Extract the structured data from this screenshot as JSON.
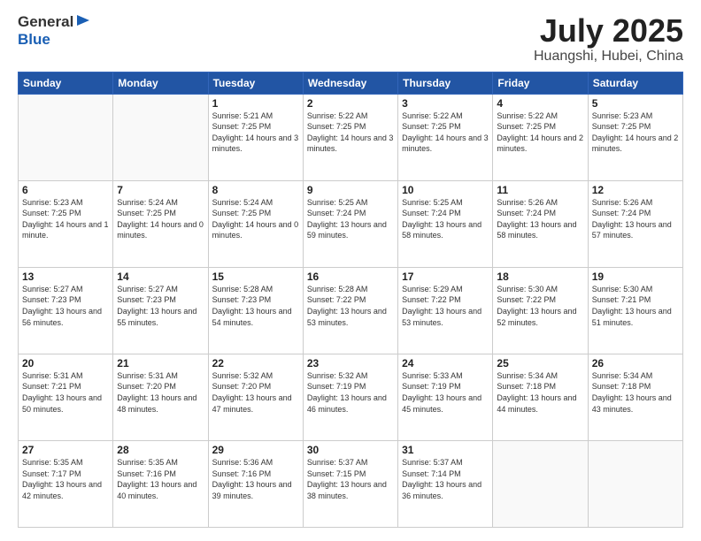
{
  "header": {
    "logo_general": "General",
    "logo_blue": "Blue",
    "month_title": "July 2025",
    "location": "Huangshi, Hubei, China"
  },
  "weekdays": [
    "Sunday",
    "Monday",
    "Tuesday",
    "Wednesday",
    "Thursday",
    "Friday",
    "Saturday"
  ],
  "weeks": [
    [
      {
        "day": "",
        "sunrise": "",
        "sunset": "",
        "daylight": ""
      },
      {
        "day": "",
        "sunrise": "",
        "sunset": "",
        "daylight": ""
      },
      {
        "day": "1",
        "sunrise": "Sunrise: 5:21 AM",
        "sunset": "Sunset: 7:25 PM",
        "daylight": "Daylight: 14 hours and 3 minutes."
      },
      {
        "day": "2",
        "sunrise": "Sunrise: 5:22 AM",
        "sunset": "Sunset: 7:25 PM",
        "daylight": "Daylight: 14 hours and 3 minutes."
      },
      {
        "day": "3",
        "sunrise": "Sunrise: 5:22 AM",
        "sunset": "Sunset: 7:25 PM",
        "daylight": "Daylight: 14 hours and 3 minutes."
      },
      {
        "day": "4",
        "sunrise": "Sunrise: 5:22 AM",
        "sunset": "Sunset: 7:25 PM",
        "daylight": "Daylight: 14 hours and 2 minutes."
      },
      {
        "day": "5",
        "sunrise": "Sunrise: 5:23 AM",
        "sunset": "Sunset: 7:25 PM",
        "daylight": "Daylight: 14 hours and 2 minutes."
      }
    ],
    [
      {
        "day": "6",
        "sunrise": "Sunrise: 5:23 AM",
        "sunset": "Sunset: 7:25 PM",
        "daylight": "Daylight: 14 hours and 1 minute."
      },
      {
        "day": "7",
        "sunrise": "Sunrise: 5:24 AM",
        "sunset": "Sunset: 7:25 PM",
        "daylight": "Daylight: 14 hours and 0 minutes."
      },
      {
        "day": "8",
        "sunrise": "Sunrise: 5:24 AM",
        "sunset": "Sunset: 7:25 PM",
        "daylight": "Daylight: 14 hours and 0 minutes."
      },
      {
        "day": "9",
        "sunrise": "Sunrise: 5:25 AM",
        "sunset": "Sunset: 7:24 PM",
        "daylight": "Daylight: 13 hours and 59 minutes."
      },
      {
        "day": "10",
        "sunrise": "Sunrise: 5:25 AM",
        "sunset": "Sunset: 7:24 PM",
        "daylight": "Daylight: 13 hours and 58 minutes."
      },
      {
        "day": "11",
        "sunrise": "Sunrise: 5:26 AM",
        "sunset": "Sunset: 7:24 PM",
        "daylight": "Daylight: 13 hours and 58 minutes."
      },
      {
        "day": "12",
        "sunrise": "Sunrise: 5:26 AM",
        "sunset": "Sunset: 7:24 PM",
        "daylight": "Daylight: 13 hours and 57 minutes."
      }
    ],
    [
      {
        "day": "13",
        "sunrise": "Sunrise: 5:27 AM",
        "sunset": "Sunset: 7:23 PM",
        "daylight": "Daylight: 13 hours and 56 minutes."
      },
      {
        "day": "14",
        "sunrise": "Sunrise: 5:27 AM",
        "sunset": "Sunset: 7:23 PM",
        "daylight": "Daylight: 13 hours and 55 minutes."
      },
      {
        "day": "15",
        "sunrise": "Sunrise: 5:28 AM",
        "sunset": "Sunset: 7:23 PM",
        "daylight": "Daylight: 13 hours and 54 minutes."
      },
      {
        "day": "16",
        "sunrise": "Sunrise: 5:28 AM",
        "sunset": "Sunset: 7:22 PM",
        "daylight": "Daylight: 13 hours and 53 minutes."
      },
      {
        "day": "17",
        "sunrise": "Sunrise: 5:29 AM",
        "sunset": "Sunset: 7:22 PM",
        "daylight": "Daylight: 13 hours and 53 minutes."
      },
      {
        "day": "18",
        "sunrise": "Sunrise: 5:30 AM",
        "sunset": "Sunset: 7:22 PM",
        "daylight": "Daylight: 13 hours and 52 minutes."
      },
      {
        "day": "19",
        "sunrise": "Sunrise: 5:30 AM",
        "sunset": "Sunset: 7:21 PM",
        "daylight": "Daylight: 13 hours and 51 minutes."
      }
    ],
    [
      {
        "day": "20",
        "sunrise": "Sunrise: 5:31 AM",
        "sunset": "Sunset: 7:21 PM",
        "daylight": "Daylight: 13 hours and 50 minutes."
      },
      {
        "day": "21",
        "sunrise": "Sunrise: 5:31 AM",
        "sunset": "Sunset: 7:20 PM",
        "daylight": "Daylight: 13 hours and 48 minutes."
      },
      {
        "day": "22",
        "sunrise": "Sunrise: 5:32 AM",
        "sunset": "Sunset: 7:20 PM",
        "daylight": "Daylight: 13 hours and 47 minutes."
      },
      {
        "day": "23",
        "sunrise": "Sunrise: 5:32 AM",
        "sunset": "Sunset: 7:19 PM",
        "daylight": "Daylight: 13 hours and 46 minutes."
      },
      {
        "day": "24",
        "sunrise": "Sunrise: 5:33 AM",
        "sunset": "Sunset: 7:19 PM",
        "daylight": "Daylight: 13 hours and 45 minutes."
      },
      {
        "day": "25",
        "sunrise": "Sunrise: 5:34 AM",
        "sunset": "Sunset: 7:18 PM",
        "daylight": "Daylight: 13 hours and 44 minutes."
      },
      {
        "day": "26",
        "sunrise": "Sunrise: 5:34 AM",
        "sunset": "Sunset: 7:18 PM",
        "daylight": "Daylight: 13 hours and 43 minutes."
      }
    ],
    [
      {
        "day": "27",
        "sunrise": "Sunrise: 5:35 AM",
        "sunset": "Sunset: 7:17 PM",
        "daylight": "Daylight: 13 hours and 42 minutes."
      },
      {
        "day": "28",
        "sunrise": "Sunrise: 5:35 AM",
        "sunset": "Sunset: 7:16 PM",
        "daylight": "Daylight: 13 hours and 40 minutes."
      },
      {
        "day": "29",
        "sunrise": "Sunrise: 5:36 AM",
        "sunset": "Sunset: 7:16 PM",
        "daylight": "Daylight: 13 hours and 39 minutes."
      },
      {
        "day": "30",
        "sunrise": "Sunrise: 5:37 AM",
        "sunset": "Sunset: 7:15 PM",
        "daylight": "Daylight: 13 hours and 38 minutes."
      },
      {
        "day": "31",
        "sunrise": "Sunrise: 5:37 AM",
        "sunset": "Sunset: 7:14 PM",
        "daylight": "Daylight: 13 hours and 36 minutes."
      },
      {
        "day": "",
        "sunrise": "",
        "sunset": "",
        "daylight": ""
      },
      {
        "day": "",
        "sunrise": "",
        "sunset": "",
        "daylight": ""
      }
    ]
  ]
}
